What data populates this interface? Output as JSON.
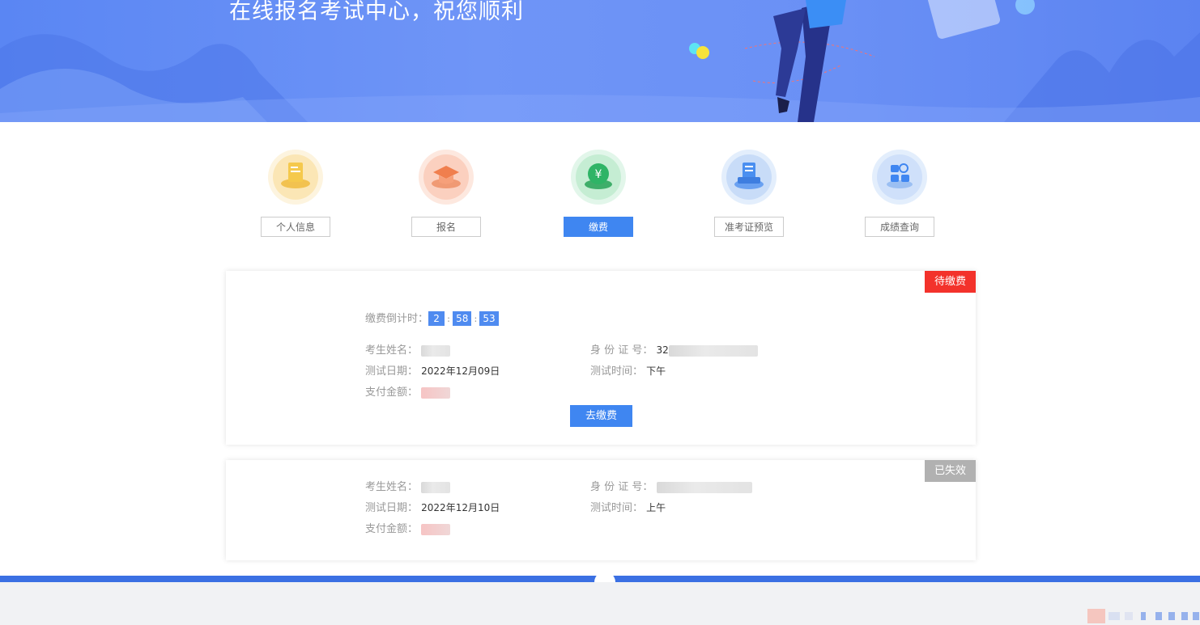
{
  "banner": {
    "title": "在线报名考试中心，祝您顺利"
  },
  "steps": [
    {
      "label": "个人信息",
      "icon": "document-icon",
      "color": "#f5c94c",
      "active": false
    },
    {
      "label": "报名",
      "icon": "graduation-cap-icon",
      "color": "#f07f4e",
      "active": false
    },
    {
      "label": "缴费",
      "icon": "yuan-coin-icon",
      "color": "#3fbf75",
      "active": true
    },
    {
      "label": "准考证预览",
      "icon": "admission-ticket-icon",
      "color": "#4a8ff0",
      "active": false
    },
    {
      "label": "成绩查询",
      "icon": "score-search-icon",
      "color": "#3f86f1",
      "active": false
    }
  ],
  "cards": [
    {
      "status": "待缴费",
      "status_color": "#f3322b",
      "countdown": {
        "label": "缴费倒计时：",
        "hours": "2",
        "minutes": "58",
        "seconds": "53"
      },
      "name_label": "考生姓名：",
      "id_label": "身 份 证 号：",
      "id_prefix": "32",
      "date_label": "测试日期：",
      "date": "2022年12月09日",
      "time_label": "测试时间：",
      "time": "下午",
      "amount_label": "支付金额：",
      "pay_button": "去缴费"
    },
    {
      "status": "已失效",
      "status_color": "#b1b1b1",
      "name_label": "考生姓名：",
      "id_label": "身 份 证 号：",
      "date_label": "测试日期：",
      "date": "2022年12月10日",
      "time_label": "测试时间：",
      "time": "上午",
      "amount_label": "支付金额："
    }
  ]
}
